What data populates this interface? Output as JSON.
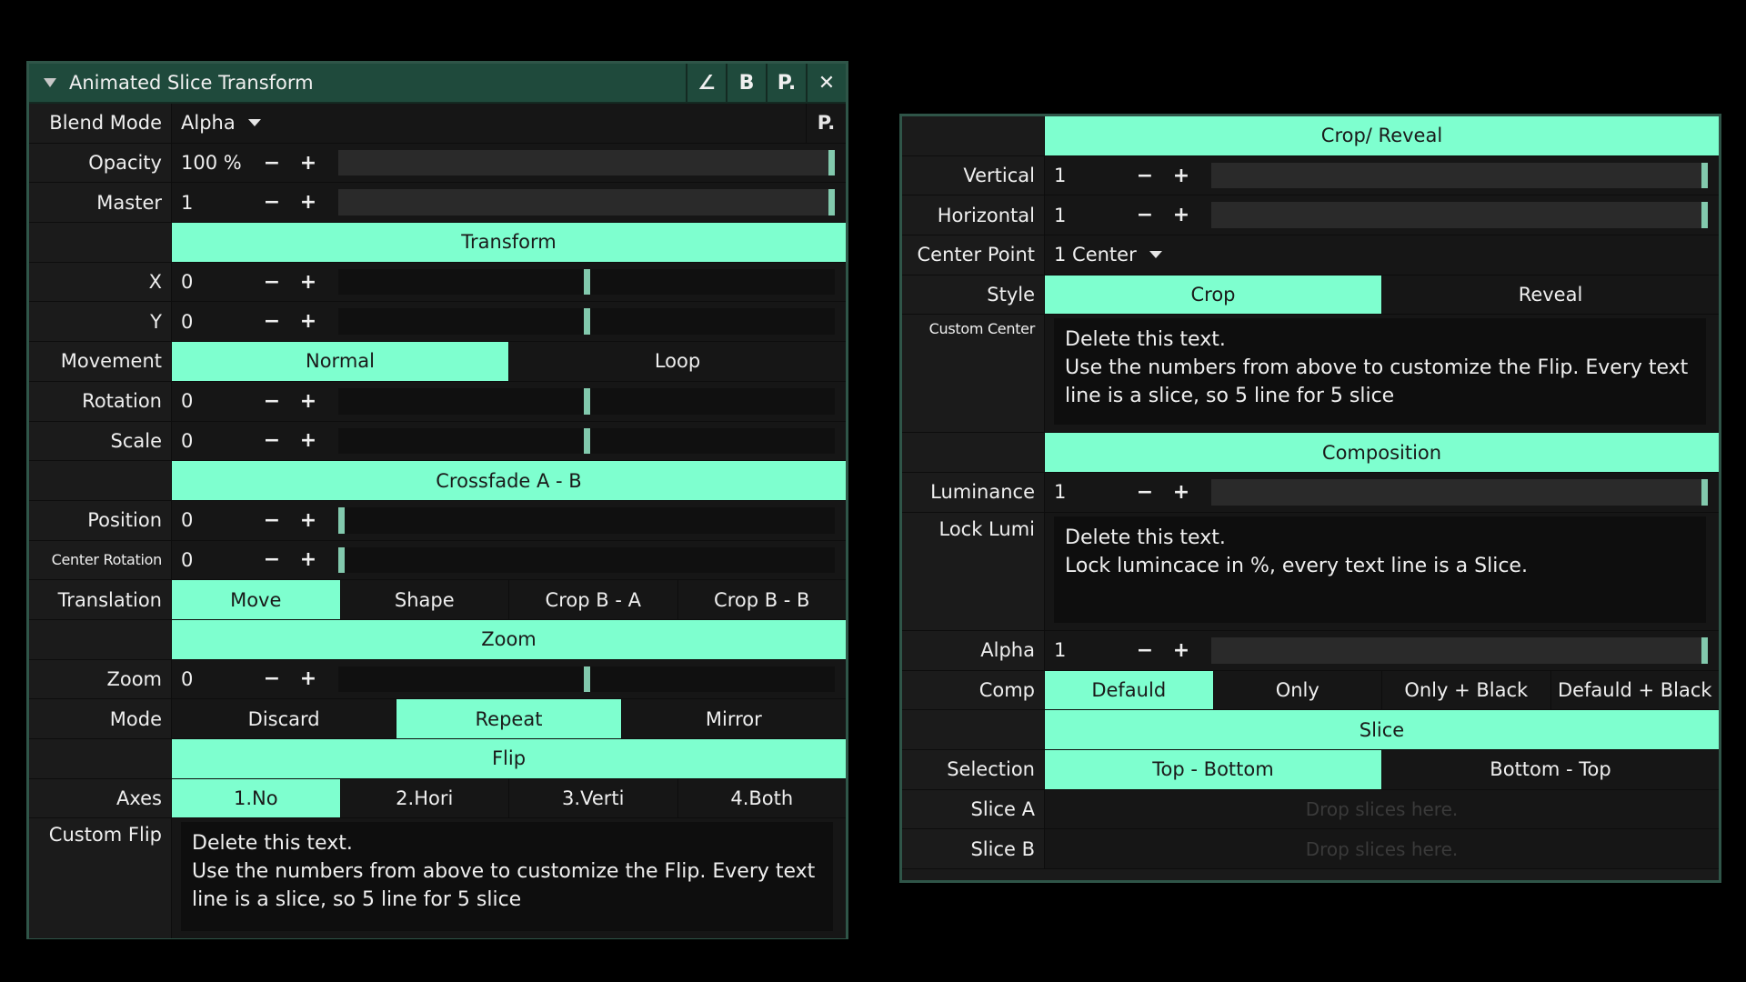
{
  "colors": {
    "accent": "#7effcf",
    "title_bar": "#1f4a3c",
    "border": "#2f5548",
    "knob": "#82c9ad",
    "background": "#000000"
  },
  "left": {
    "title": "Animated Slice Transform",
    "title_buttons": [
      "∠",
      "B",
      "P.",
      "✕"
    ],
    "blend_mode": {
      "label": "Blend Mode",
      "value": "Alpha",
      "p_button": "P."
    },
    "opacity": {
      "label": "Opacity",
      "value": "100 %",
      "fraction": 1.0
    },
    "master": {
      "label": "Master",
      "value": "1",
      "fraction": 1.0
    },
    "transform_header": "Transform",
    "x": {
      "label": "X",
      "value": "0",
      "fraction": 0.5
    },
    "y": {
      "label": "Y",
      "value": "0",
      "fraction": 0.5
    },
    "movement": {
      "label": "Movement",
      "options": [
        "Normal",
        "Loop"
      ],
      "active": 0
    },
    "rotation": {
      "label": "Rotation",
      "value": "0",
      "fraction": 0.5
    },
    "scale": {
      "label": "Scale",
      "value": "0",
      "fraction": 0.5
    },
    "crossfade_header": "Crossfade  A - B",
    "position": {
      "label": "Position",
      "value": "0",
      "fraction": 0.0
    },
    "center_rotation": {
      "label": "Center Rotation",
      "value": "0",
      "fraction": 0.0
    },
    "translation": {
      "label": "Translation",
      "options": [
        "Move",
        "Shape",
        "Crop B - A",
        "Crop B - B"
      ],
      "active": 0
    },
    "zoom_header": "Zoom",
    "zoom": {
      "label": "Zoom",
      "value": "0",
      "fraction": 0.5
    },
    "mode": {
      "label": "Mode",
      "options": [
        "Discard",
        "Repeat",
        "Mirror"
      ],
      "active": 1
    },
    "flip_header": "Flip",
    "axes": {
      "label": "Axes",
      "options": [
        "1.No",
        "2.Hori",
        "3.Verti",
        "4.Both"
      ],
      "active": 0
    },
    "custom_flip": {
      "label": "Custom Flip",
      "lines": [
        "Delete this text.",
        "Use the numbers from above to customize  the Flip. Every text",
        "line is a slice, so 5 line for 5 slice"
      ]
    }
  },
  "right": {
    "crop_header": "Crop/ Reveal",
    "vertical": {
      "label": "Vertical",
      "value": "1",
      "fraction": 1.0
    },
    "horizontal": {
      "label": "Horizontal",
      "value": "1",
      "fraction": 1.0
    },
    "center_point": {
      "label": "Center Point",
      "value": "1 Center"
    },
    "style": {
      "label": "Style",
      "options": [
        "Crop",
        "Reveal"
      ],
      "active": 0
    },
    "custom_center": {
      "label": "Custom Center",
      "lines": [
        "Delete this text.",
        "Use the numbers from above to customize  the Flip. Every text",
        "line is a slice, so 5 line for 5 slice"
      ]
    },
    "composition_header": "Composition",
    "luminance": {
      "label": "Luminance",
      "value": "1",
      "fraction": 1.0
    },
    "lock_lumi": {
      "label": "Lock Lumi",
      "lines": [
        "Delete this text.",
        "Lock lumincace in %, every text line is a Slice."
      ]
    },
    "alpha": {
      "label": "Alpha",
      "value": "1",
      "fraction": 1.0
    },
    "comp": {
      "label": "Comp",
      "options": [
        "Defauld",
        "Only",
        "Only + Black",
        "Defauld + Black"
      ],
      "active": 0
    },
    "slice_header": "Slice",
    "selection": {
      "label": "Selection",
      "options": [
        "Top -  Bottom",
        "Bottom - Top"
      ],
      "active": 0
    },
    "slice_a": {
      "label": "Slice A",
      "placeholder": "Drop slices here."
    },
    "slice_b": {
      "label": "Slice B",
      "placeholder": "Drop slices here."
    }
  }
}
